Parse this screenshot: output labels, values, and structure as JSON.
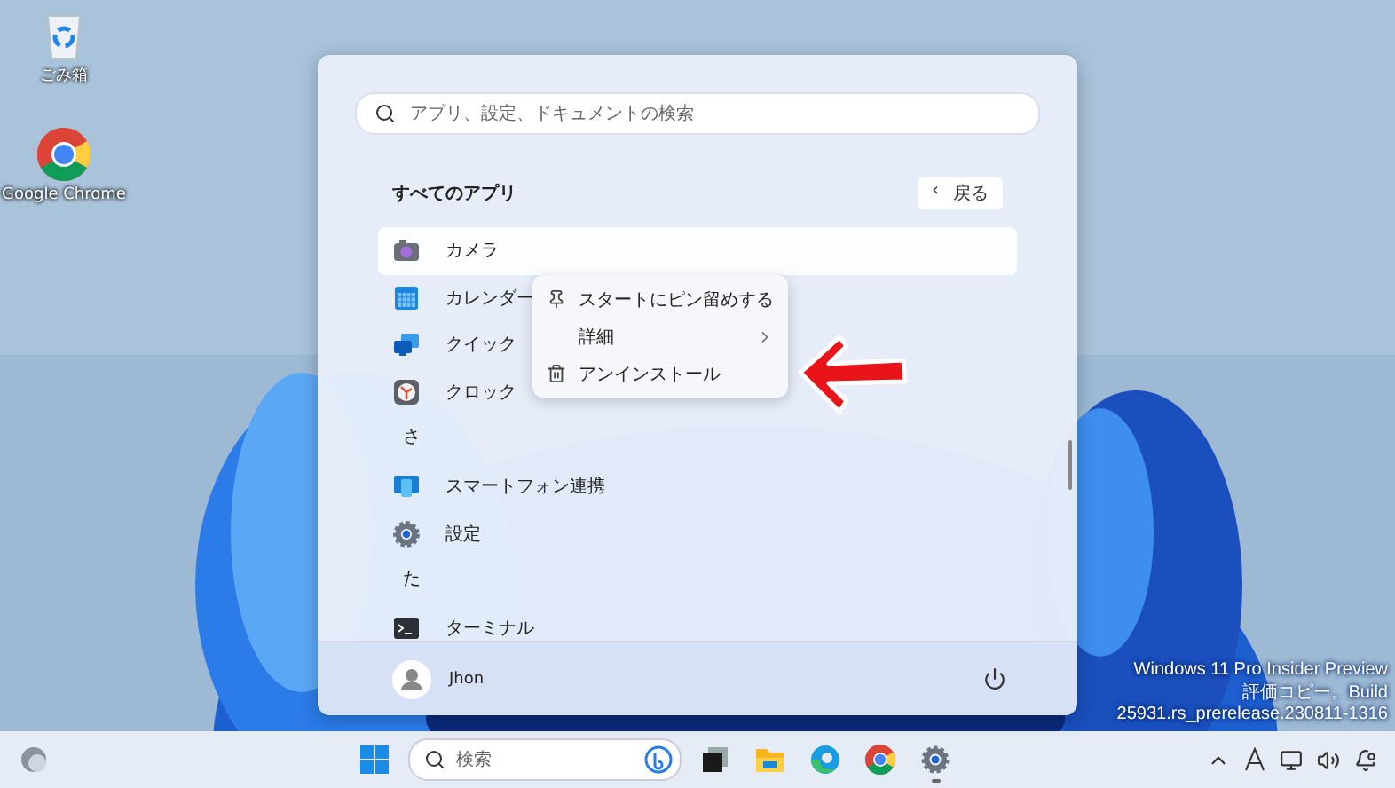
{
  "desktop_icons": [
    {
      "kind": "recycle-bin",
      "label": "ごみ箱"
    },
    {
      "kind": "chrome",
      "label": "Google Chrome"
    }
  ],
  "start_menu": {
    "search": {
      "placeholder": "アプリ、設定、ドキュメントの検索"
    },
    "heading": "すべてのアプリ",
    "back_button": {
      "icon": "‹",
      "label": "戻る"
    },
    "apps": [
      {
        "kind": "app",
        "label": "カメラ",
        "selected": true
      },
      {
        "kind": "app",
        "label": "カレンダー",
        "selected": false
      },
      {
        "kind": "app",
        "label": "クイック",
        "selected": false
      },
      {
        "kind": "app",
        "label": "クロック",
        "selected": false
      },
      {
        "kind": "letter",
        "label": "さ"
      },
      {
        "kind": "app",
        "label": "スマートフォン連携",
        "selected": false
      },
      {
        "kind": "app",
        "label": "設定",
        "selected": false
      },
      {
        "kind": "letter",
        "label": "た"
      },
      {
        "kind": "app",
        "label": "ターミナル",
        "selected": false
      }
    ],
    "context_menu": [
      {
        "label": "スタートにピン留めする",
        "submenu": false
      },
      {
        "label": "詳細",
        "submenu": true
      },
      {
        "label": "アンインストール",
        "submenu": false
      }
    ],
    "user": {
      "name": "Jhon"
    }
  },
  "build_info": [
    "Windows 11 Pro Insider Preview",
    "評価コピー。Build 25931.rs_prerelease.230811-1316"
  ],
  "taskbar": {
    "search": {
      "placeholder": "検索"
    },
    "apps": [
      {
        "kind": "task-view",
        "running": false
      },
      {
        "kind": "explorer",
        "running": false
      },
      {
        "kind": "edge",
        "running": false
      },
      {
        "kind": "chrome",
        "running": false
      },
      {
        "kind": "settings",
        "running": true
      }
    ]
  }
}
